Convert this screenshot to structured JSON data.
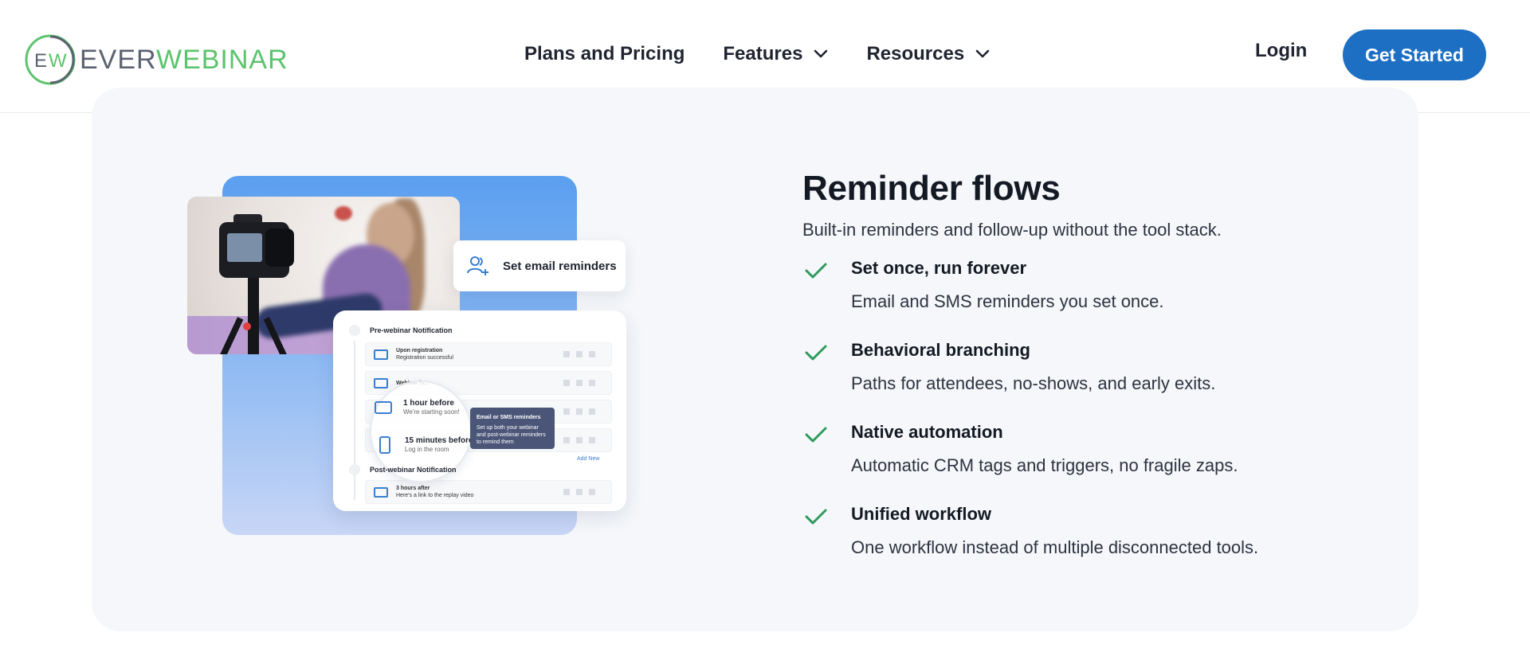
{
  "brand": {
    "logo_mark": "EW",
    "name_part1": "EVER",
    "name_part2": "WEBINAR",
    "colors": {
      "green": "#5cc36d",
      "gray": "#5b6270",
      "primary_blue": "#1d6fc4"
    }
  },
  "nav": {
    "items": [
      {
        "label": "Plans and Pricing",
        "has_dropdown": false
      },
      {
        "label": "Features",
        "has_dropdown": true,
        "icon": "chevron-down-icon"
      },
      {
        "label": "Resources",
        "has_dropdown": true,
        "icon": "chevron-down-icon"
      }
    ],
    "login_label": "Login",
    "cta_label": "Get Started"
  },
  "section": {
    "title": "Reminder flows",
    "subtitle": "Built-in reminders and follow-up without the tool stack.",
    "features": [
      {
        "title": "Set once, run forever",
        "description": "Email and SMS reminders you set once.",
        "icon": "check-icon"
      },
      {
        "title": "Behavioral branching",
        "description": "Paths for attendees, no-shows, and early exits.",
        "icon": "check-icon"
      },
      {
        "title": "Native automation",
        "description": "Automatic CRM tags and triggers, no fragile zaps.",
        "icon": "check-icon"
      },
      {
        "title": "Unified workflow",
        "description": "One workflow instead of multiple disconnected tools.",
        "icon": "check-icon"
      }
    ]
  },
  "illustration": {
    "pill_label": "Set email reminders",
    "pill_icon": "user-add-icon",
    "flow_header": "Pre-webinar Notification",
    "rows": [
      {
        "title": "Upon registration",
        "subtitle": "Registration successful"
      },
      {
        "title": "Webinar is..."
      },
      {
        "title": ""
      },
      {
        "title": ""
      },
      {
        "title": "3 hours after",
        "subtitle": "Here's a link to the replay video"
      }
    ],
    "lens_rows": [
      {
        "title": "1 hour before",
        "subtitle": "We're starting soon!",
        "icon": "mail-icon"
      },
      {
        "title": "15 minutes before",
        "subtitle": "Log in the room",
        "icon": "phone-icon"
      }
    ],
    "tooltip_title": "Email or SMS reminders",
    "tooltip_text": "Set up both your webinar and post-webinar reminders to remind them",
    "add_new": "Add New",
    "post_header": "Post-webinar Notification"
  }
}
